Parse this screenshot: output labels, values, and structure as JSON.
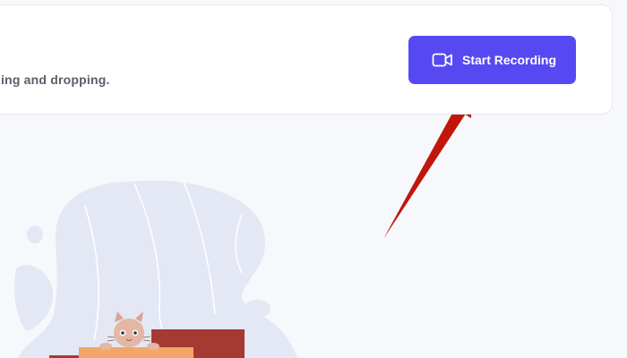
{
  "card": {
    "subtitle": "ing and dropping.",
    "record_button_label": "Start Recording"
  },
  "icons": {
    "record": "video-camera-icon"
  },
  "colors": {
    "accent": "#5749f2",
    "arrow": "#c0160c",
    "background": "#f7f8fc",
    "blob": "#e4e8f4"
  }
}
